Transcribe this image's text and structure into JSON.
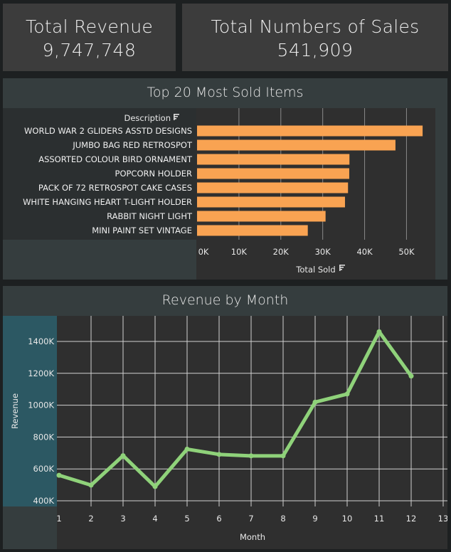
{
  "kpis": {
    "revenue": {
      "label": "Total Revenue",
      "value": "9,747,748"
    },
    "sales": {
      "label": "Total Numbers of Sales",
      "value": "541,909"
    }
  },
  "colors": {
    "bar": "#f9a352",
    "line": "#8fd27a",
    "panel": "#353d3e",
    "plot": "#2f2f2f",
    "axis_band": "#2c5863"
  },
  "chart_data": [
    {
      "type": "bar",
      "title": "Top 20 Most Sold Items",
      "row_header": "Description",
      "xlabel": "Total Sold",
      "orientation": "horizontal",
      "categories": [
        "WORLD WAR 2 GLIDERS ASSTD DESIGNS",
        "JUMBO BAG RED RETROSPOT",
        "ASSORTED COLOUR BIRD ORNAMENT",
        "POPCORN HOLDER",
        "PACK OF 72 RETROSPOT CAKE CASES",
        "WHITE HANGING HEART T-LIGHT HOLDER",
        "RABBIT NIGHT LIGHT",
        "MINI PAINT SET VINTAGE"
      ],
      "values": [
        53847,
        47363,
        36381,
        36334,
        36039,
        35317,
        30680,
        26437
      ],
      "xlim": [
        0,
        55000
      ],
      "xticks": [
        "0K",
        "10K",
        "20K",
        "30K",
        "40K",
        "50K"
      ],
      "grid": true,
      "legend": "none"
    },
    {
      "type": "line",
      "title": "Revenue by Month",
      "xlabel": "Month",
      "ylabel": "Revenue",
      "x": [
        1,
        2,
        3,
        4,
        5,
        6,
        7,
        8,
        9,
        10,
        11,
        12
      ],
      "values": [
        560000,
        498000,
        683000,
        489000,
        724000,
        691000,
        682000,
        682000,
        1019000,
        1070000,
        1461000,
        1183000
      ],
      "xlim": [
        1,
        13
      ],
      "ylim": [
        380000,
        1550000
      ],
      "xticks": [
        "1",
        "2",
        "3",
        "4",
        "5",
        "6",
        "7",
        "8",
        "9",
        "10",
        "11",
        "12",
        "13"
      ],
      "yticks": [
        "400K",
        "600K",
        "800K",
        "1000K",
        "1200K",
        "1400K"
      ],
      "grid": true,
      "legend": "none"
    }
  ]
}
